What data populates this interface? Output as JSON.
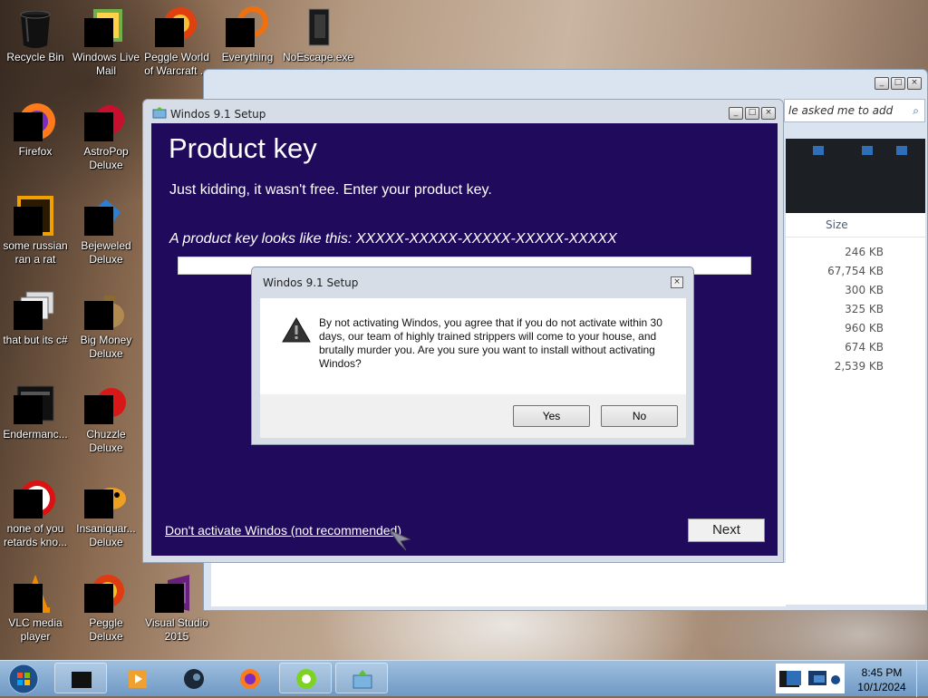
{
  "desktop": {
    "icons": [
      {
        "name": "recycle-bin",
        "label": "Recycle Bin"
      },
      {
        "name": "windows-live-mail",
        "label": "Windows Live Mail"
      },
      {
        "name": "peggle-world-of-warcraft",
        "label": "Peggle World of Warcraft ..."
      },
      {
        "name": "everything",
        "label": "Everything"
      },
      {
        "name": "noescape",
        "label": "NoEscape.exe"
      },
      {
        "name": "firefox",
        "label": "Firefox"
      },
      {
        "name": "astropop-deluxe",
        "label": "AstroPop Deluxe"
      },
      {
        "name": "russian-rat",
        "label": "some russian ran a rat"
      },
      {
        "name": "bejeweled-deluxe",
        "label": "Bejeweled Deluxe"
      },
      {
        "name": "that-but-c-sharp",
        "label": "that but its c#"
      },
      {
        "name": "big-money-deluxe",
        "label": "Big Money Deluxe"
      },
      {
        "name": "enderman",
        "label": "Endermanc..."
      },
      {
        "name": "chuzzle-deluxe",
        "label": "Chuzzle Deluxe"
      },
      {
        "name": "none-of-you",
        "label": "none of you retards kno..."
      },
      {
        "name": "insaniquarium-deluxe",
        "label": "Insaniquar... Deluxe"
      },
      {
        "name": "vlc",
        "label": "VLC media player"
      },
      {
        "name": "peggle-deluxe",
        "label": "Peggle Deluxe"
      },
      {
        "name": "visual-studio",
        "label": "Visual Studio 2015"
      }
    ]
  },
  "explorer": {
    "search_placeholder": "le asked me to add",
    "column_size": "Size",
    "sizes": [
      "246 KB",
      "67,754 KB",
      "300 KB",
      "325 KB",
      "960 KB",
      "674 KB",
      "2,539 KB"
    ]
  },
  "setup": {
    "title": "Windos 9.1 Setup",
    "heading": "Product key",
    "subheading": "Just kidding, it wasn't free. Enter your product key.",
    "example": "A product key looks like this: XXXXX-XXXXX-XXXXX-XXXXX-XXXXX",
    "product_key_value": "",
    "dont_activate_link": "Don't activate Windos (not recommended)",
    "next_label": "Next"
  },
  "dialog": {
    "title": "Windos 9.1 Setup",
    "message": "By not activating Windos, you agree that if you do not activate within 30 days, our team of highly trained strippers will come to your house, and brutally murder you. Are you sure you want to install without activating Windos?",
    "yes_label": "Yes",
    "no_label": "No"
  },
  "taskbar": {
    "time": "8:45 PM",
    "date": "10/1/2024",
    "apps": [
      "dark-window-app",
      "media-player-app",
      "steam-app",
      "firefox-app",
      "lime-app",
      "setup-app"
    ]
  },
  "colors": {
    "setup_background": "#1f0a5c",
    "taskbar": "#8fb2d6"
  }
}
